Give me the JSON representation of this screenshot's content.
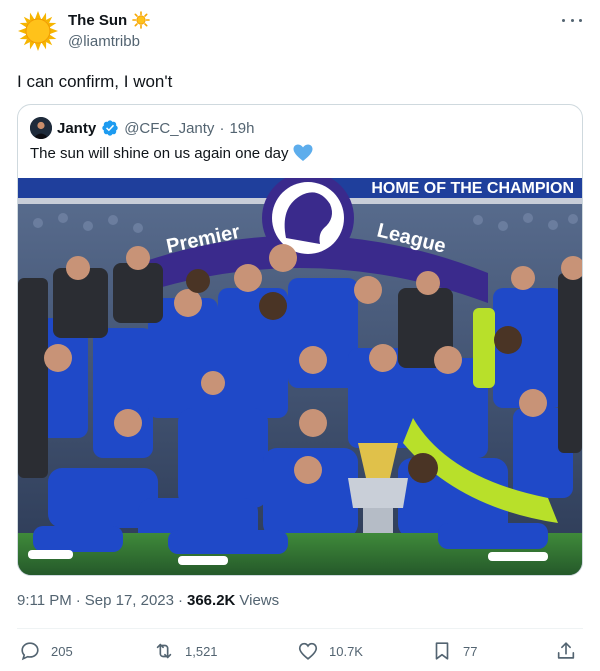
{
  "author": {
    "name": "The Sun",
    "handle": "@liamtribb"
  },
  "tweet_text": "I can confirm, I won't",
  "quoted": {
    "name": "Janty",
    "handle": "@CFC_Janty",
    "separator": "·",
    "time": "19h",
    "text": "The sun will shine on us again one day",
    "image": {
      "banner_text": "HOME OF THE CHAMPION",
      "board_left": "Premier",
      "board_right": "League",
      "description_colors": {
        "kit": "#1f49c8",
        "banner": "#3a2a8c",
        "crowd": "#3c4a66",
        "grass": "#2f6b2f"
      }
    }
  },
  "meta": {
    "time": "9:11 PM",
    "separator1": "·",
    "date": "Sep 17, 2023",
    "separator2": "·",
    "views_count": "366.2K",
    "views_label": "Views"
  },
  "actions": {
    "replies": "205",
    "retweets": "1,521",
    "likes": "10.7K",
    "bookmarks": "77"
  },
  "icons": [
    "sun-emoji-icon",
    "sun-small-icon",
    "verified-icon",
    "blue-heart-icon",
    "reply-icon",
    "retweet-icon",
    "like-icon",
    "bookmark-icon",
    "share-icon",
    "more-icon"
  ],
  "colors": {
    "text": "#0f1419",
    "muted": "#536471",
    "verified": "#1d9bf0",
    "border": "#cfd9de"
  }
}
